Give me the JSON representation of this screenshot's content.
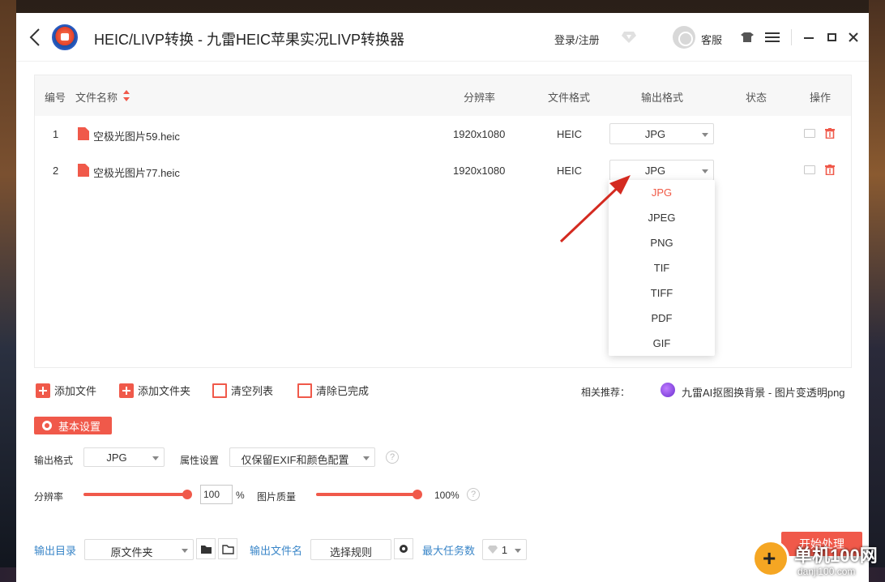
{
  "window": {
    "title": "HEIC/LIVP转换 - 九雷HEIC苹果实况LIVP转换器",
    "login": "登录/注册",
    "service": "客服"
  },
  "table": {
    "headers": {
      "index": "编号",
      "filename": "文件名称",
      "resolution": "分辨率",
      "file_format": "文件格式",
      "output_format": "输出格式",
      "status": "状态",
      "actions": "操作"
    },
    "rows": [
      {
        "index": "1",
        "filename": "空极光图片59.heic",
        "resolution": "1920x1080",
        "format": "HEIC",
        "output": "JPG",
        "status": ""
      },
      {
        "index": "2",
        "filename": "空极光图片77.heic",
        "resolution": "1920x1080",
        "format": "HEIC",
        "output": "JPG",
        "status": ""
      }
    ]
  },
  "dropdown": {
    "options": [
      "JPG",
      "JPEG",
      "PNG",
      "TIF",
      "TIFF",
      "PDF",
      "GIF"
    ],
    "selected": "JPG"
  },
  "actions": {
    "add_file": "添加文件",
    "add_folder": "添加文件夹",
    "clear_list": "清空列表",
    "clear_done": "清除已完成",
    "recommend_label": "相关推荐：",
    "recommend_link": "九雷AI抠图换背景 - 图片变透明png"
  },
  "settings": {
    "button": "基本设置",
    "output_format_label": "输出格式",
    "output_format_value": "JPG",
    "attr_label": "属性设置",
    "attr_value": "仅保留EXIF和颜色配置",
    "resolution_label": "分辨率",
    "resolution_value": "100",
    "resolution_unit": "%",
    "resolution_level": 1.0,
    "quality_label": "图片质量",
    "quality_value": "100%",
    "quality_level": 1.0,
    "help": "?"
  },
  "bottom": {
    "output_dir_label": "输出目录",
    "output_dir_value": "原文件夹",
    "output_name_label": "输出文件名",
    "rule_button": "选择规则",
    "max_tasks_label": "最大任务数",
    "max_tasks_value": "1",
    "start_button": "开始处理"
  },
  "watermark": {
    "text": "单机100网",
    "url": "danji100.com"
  },
  "colors": {
    "accent": "#f0594a",
    "link_blue": "#3a86c8"
  }
}
